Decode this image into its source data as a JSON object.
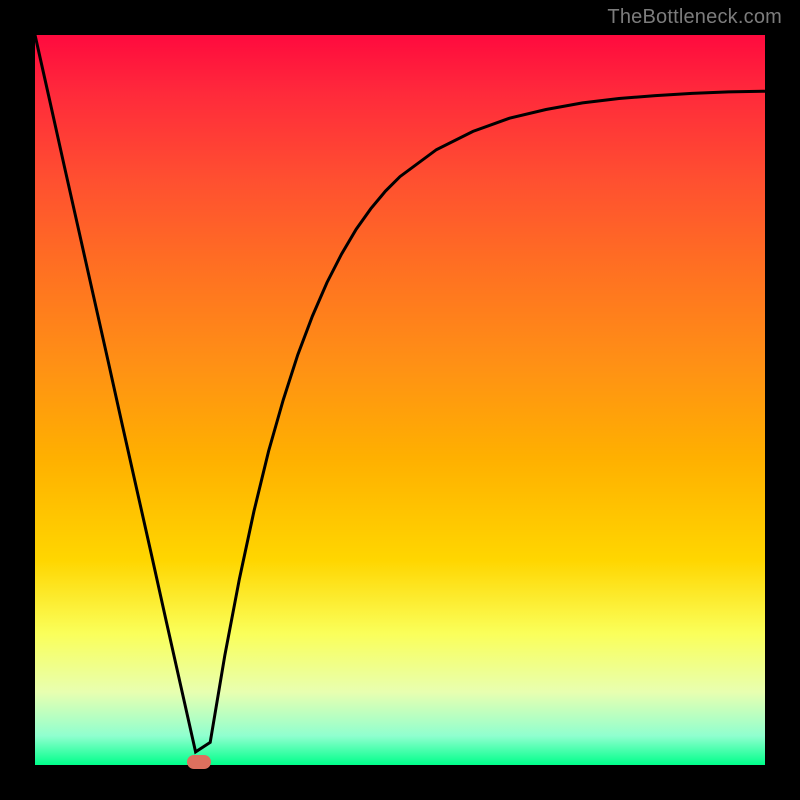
{
  "watermark": "TheBottleneck.com",
  "colors": {
    "curve_stroke": "#000000",
    "marker_fill": "#dd705e",
    "frame_bg": "#000000"
  },
  "chart_data": {
    "type": "line",
    "title": "",
    "xlabel": "",
    "ylabel": "",
    "xlim": [
      0,
      1
    ],
    "ylim": [
      0,
      1
    ],
    "x": [
      0.0,
      0.02,
      0.04,
      0.06,
      0.08,
      0.1,
      0.12,
      0.14,
      0.16,
      0.18,
      0.2,
      0.22,
      0.24,
      0.26,
      0.28,
      0.3,
      0.32,
      0.34,
      0.36,
      0.38,
      0.4,
      0.42,
      0.44,
      0.46,
      0.48,
      0.5,
      0.55,
      0.6,
      0.65,
      0.7,
      0.75,
      0.8,
      0.85,
      0.9,
      0.95,
      1.0
    ],
    "values": [
      1.0,
      0.911,
      0.821,
      0.732,
      0.643,
      0.554,
      0.464,
      0.375,
      0.286,
      0.196,
      0.107,
      0.018,
      0.031,
      0.15,
      0.255,
      0.348,
      0.43,
      0.5,
      0.562,
      0.615,
      0.661,
      0.7,
      0.734,
      0.762,
      0.786,
      0.806,
      0.843,
      0.868,
      0.886,
      0.898,
      0.907,
      0.913,
      0.917,
      0.92,
      0.922,
      0.923
    ],
    "minimum": {
      "x": 0.224,
      "y": 0.0
    },
    "grid": false,
    "legend": false
  }
}
